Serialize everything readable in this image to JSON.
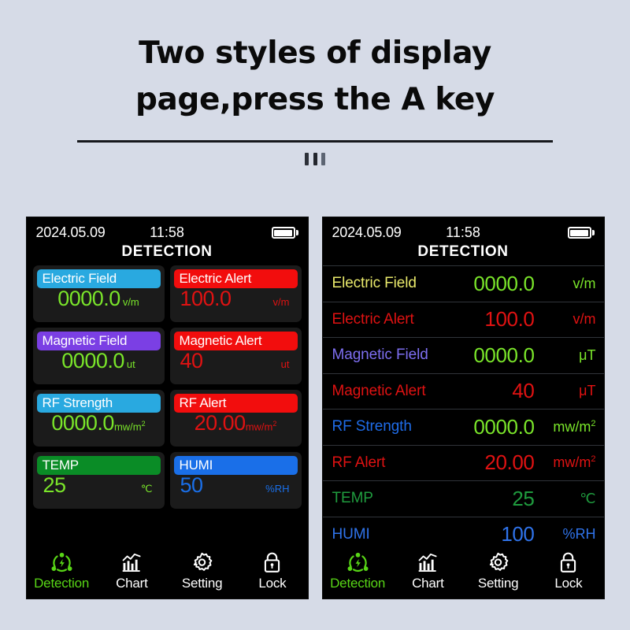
{
  "header": {
    "title": "Two styles of display page,press the A key",
    "handle_icon": "drag-handle-icon"
  },
  "colors": {
    "page_background": "#d6dbe7",
    "screen_background": "#000000",
    "card_background": "#1b1b1b",
    "green_value": "#7ae52a",
    "red_value": "#e01212",
    "blue_value": "#1a6fe8",
    "accent_green": "#58d616",
    "pill_electric": "#29a9e0",
    "pill_magnetic": "#7b3fe4",
    "pill_rf": "#29a9e0",
    "pill_alert": "#f20d0d",
    "pill_temp": "#0a8c26",
    "pill_humi": "#1a6fe8",
    "row_label_electric_field": "#e9e96b",
    "row_label_magnetic_field": "#7d6ef0",
    "row_label_rf_strength": "#1f6ce8",
    "row_label_alert": "#e01212",
    "row_label_temp": "#1f9b3e",
    "row_label_humi": "#2f73ea",
    "row_divider": "#30343a"
  },
  "device_left": {
    "statusbar": {
      "date": "2024.05.09",
      "time": "11:58",
      "battery_icon": "battery-full-icon"
    },
    "screen_title": "DETECTION",
    "cards": [
      {
        "label": "Electric Field",
        "pill_color": "#29a9e0",
        "value": "0000.0",
        "value_color": "#7ae52a",
        "unit": "v/m",
        "unit_color": "#7ae52a",
        "unit_sup": ""
      },
      {
        "label": "Electric Alert",
        "pill_color": "#f20d0d",
        "value": "100.0",
        "value_color": "#e01212",
        "unit": "v/m",
        "unit_color": "#e01212",
        "unit_sup": ""
      },
      {
        "label": "Magnetic Field",
        "pill_color": "#7b3fe4",
        "value": "0000.0",
        "value_color": "#7ae52a",
        "unit": "ut",
        "unit_color": "#7ae52a",
        "unit_sup": ""
      },
      {
        "label": "Magnetic Alert",
        "pill_color": "#f20d0d",
        "value": "40",
        "value_color": "#e01212",
        "unit": "ut",
        "unit_color": "#e01212",
        "unit_sup": ""
      },
      {
        "label": "RF Strength",
        "pill_color": "#29a9e0",
        "value": "0000.0",
        "value_color": "#7ae52a",
        "unit": "mw/m",
        "unit_color": "#7ae52a",
        "unit_sup": "2"
      },
      {
        "label": "RF Alert",
        "pill_color": "#f20d0d",
        "value": "20.00",
        "value_color": "#e01212",
        "unit": "mw/m",
        "unit_color": "#e01212",
        "unit_sup": "2"
      },
      {
        "label": "TEMP",
        "pill_color": "#0a8c26",
        "value": "25",
        "value_color": "#7ae52a",
        "unit": "℃",
        "unit_color": "#7ae52a",
        "unit_sup": ""
      },
      {
        "label": "HUMI",
        "pill_color": "#1a6fe8",
        "value": "50",
        "value_color": "#1a6fe8",
        "unit": "%RH",
        "unit_color": "#1a6fe8",
        "unit_sup": ""
      }
    ],
    "nav": [
      {
        "label": "Detection",
        "icon": "emf-detection-icon",
        "active": true
      },
      {
        "label": "Chart",
        "icon": "bar-chart-icon",
        "active": false
      },
      {
        "label": "Setting",
        "icon": "gear-icon",
        "active": false
      },
      {
        "label": "Lock",
        "icon": "lock-icon",
        "active": false
      }
    ]
  },
  "device_right": {
    "statusbar": {
      "date": "2024.05.09",
      "time": "11:58",
      "battery_icon": "battery-full-icon"
    },
    "screen_title": "DETECTION",
    "rows": [
      {
        "label": "Electric Field",
        "label_color": "#e9e96b",
        "value": "0000.0",
        "value_color": "#7ae52a",
        "unit": "v/m",
        "unit_color": "#7ae52a",
        "unit_sup": ""
      },
      {
        "label": "Electric Alert",
        "label_color": "#e01212",
        "value": "100.0",
        "value_color": "#e01212",
        "unit": "v/m",
        "unit_color": "#e01212",
        "unit_sup": ""
      },
      {
        "label": "Magnetic Field",
        "label_color": "#7d6ef0",
        "value": "0000.0",
        "value_color": "#7ae52a",
        "unit": "μT",
        "unit_color": "#7ae52a",
        "unit_sup": ""
      },
      {
        "label": "Magnetic Alert",
        "label_color": "#e01212",
        "value": "40",
        "value_color": "#e01212",
        "unit": "μT",
        "unit_color": "#e01212",
        "unit_sup": ""
      },
      {
        "label": "RF Strength",
        "label_color": "#1f6ce8",
        "value": "0000.0",
        "value_color": "#7ae52a",
        "unit": "mw/m",
        "unit_color": "#7ae52a",
        "unit_sup": "2"
      },
      {
        "label": "RF Alert",
        "label_color": "#e01212",
        "value": "20.00",
        "value_color": "#e01212",
        "unit": "mw/m",
        "unit_color": "#e01212",
        "unit_sup": "2"
      },
      {
        "label": "TEMP",
        "label_color": "#1f9b3e",
        "value": "25",
        "value_color": "#1f9b3e",
        "unit": "℃",
        "unit_color": "#1f9b3e",
        "unit_sup": ""
      },
      {
        "label": "HUMI",
        "label_color": "#2f73ea",
        "value": "100",
        "value_color": "#2f73ea",
        "unit": "%RH",
        "unit_color": "#2f73ea",
        "unit_sup": ""
      }
    ],
    "nav": [
      {
        "label": "Detection",
        "icon": "emf-detection-icon",
        "active": true
      },
      {
        "label": "Chart",
        "icon": "bar-chart-icon",
        "active": false
      },
      {
        "label": "Setting",
        "icon": "gear-icon",
        "active": false
      },
      {
        "label": "Lock",
        "icon": "lock-icon",
        "active": false
      }
    ]
  }
}
